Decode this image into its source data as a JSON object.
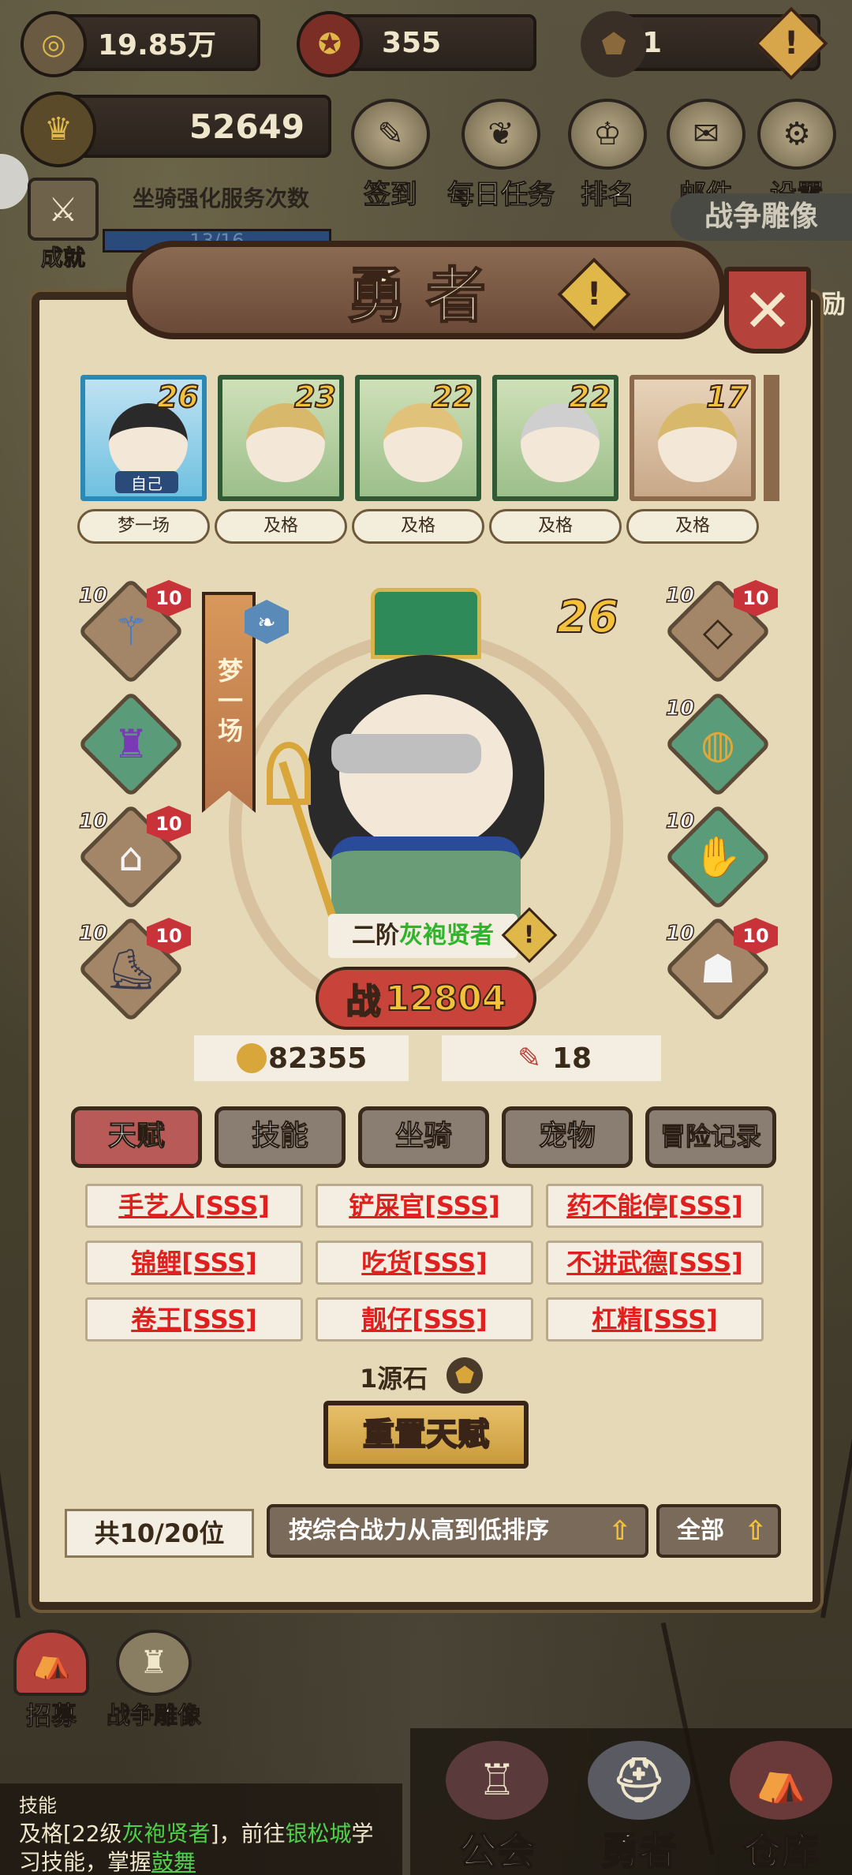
{
  "resources": {
    "gold": "19.85万",
    "medal": "355",
    "source_stone": "1",
    "power": "52649"
  },
  "top_menu": [
    {
      "label": "签到",
      "icon": "feather-icon"
    },
    {
      "label": "每日任务",
      "icon": "scroll-icon"
    },
    {
      "label": "排名",
      "icon": "crown-icon"
    },
    {
      "label": "邮件",
      "icon": "mail-icon"
    },
    {
      "label": "设置",
      "icon": "gear-icon"
    }
  ],
  "mount_service": {
    "label": "坐骑强化服务次数",
    "count": "13/16"
  },
  "achievement_label": "成就",
  "war_statue_label": "战争雕像",
  "encourage_label": "励",
  "panel": {
    "title": "勇者",
    "heroes": [
      {
        "level": "26",
        "name": "梦一场",
        "tag": "自己",
        "selected": true
      },
      {
        "level": "23",
        "name": "及格"
      },
      {
        "level": "22",
        "name": "及格"
      },
      {
        "level": "22",
        "name": "及格"
      },
      {
        "level": "17",
        "name": "及格"
      }
    ],
    "equipment_level": "10",
    "upgrade_badge": "10",
    "hero_name_vertical": "梦一场",
    "hero_level": "26",
    "class_prefix": "二阶",
    "class_name": "灰袍贤者",
    "battle_power": "12804",
    "battle_prefix": "战",
    "gold_cost": "82355",
    "scroll_cost": "18",
    "tabs": [
      "天赋",
      "技能",
      "坐骑",
      "宠物",
      "冒险记录"
    ],
    "talents": [
      "手艺人[SSS]",
      "铲屎官[SSS]",
      "药不能停[SSS]",
      "锦鲤[SSS]",
      "吃货[SSS]",
      "不讲武德[SSS]",
      "卷王[SSS]",
      "靓仔[SSS]",
      "杠精[SSS]"
    ],
    "reset_cost": "1源石",
    "reset_button": "重置天赋",
    "count_label": "共10/20位",
    "sort_label": "按综合战力从高到低排序",
    "filter_label": "全部"
  },
  "bottom_left": [
    {
      "label": "招募"
    },
    {
      "label": "战争雕像"
    }
  ],
  "task": {
    "title": "技能",
    "text_before": "及格[22级",
    "class_highlight": "灰袍贤者",
    "text_mid": "]，前往",
    "city_highlight": "银松城",
    "text_after": "学习技能，掌握",
    "link": "鼓舞"
  },
  "bottom_nav": [
    "公会",
    "勇者",
    "仓库"
  ],
  "colors": {
    "talent_red": "#e0201e",
    "class_green": "#2fb52a",
    "task_green": "#4fd04a",
    "active_tab": "#b85a58"
  }
}
